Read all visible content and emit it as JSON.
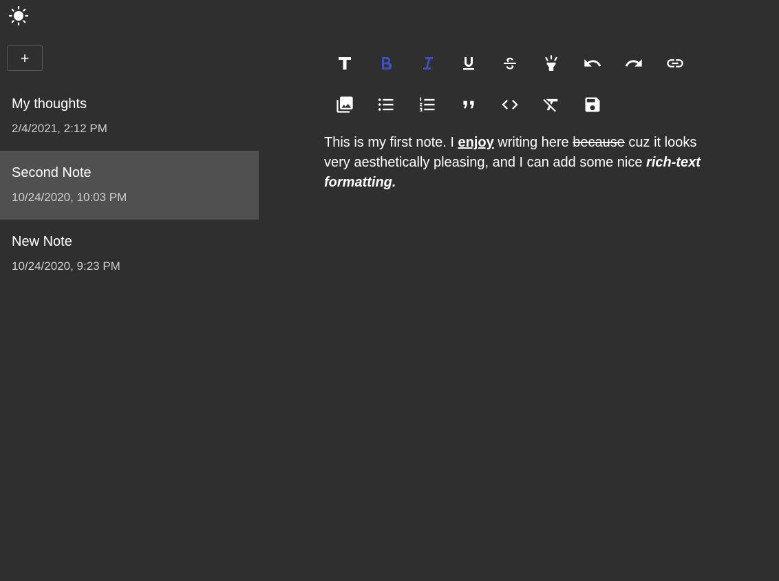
{
  "theme_toggle": {
    "icon": "sun-icon"
  },
  "sidebar": {
    "add_button_label": "+",
    "notes": [
      {
        "title": "My thoughts",
        "date": "2/4/2021, 2:12 PM",
        "selected": false
      },
      {
        "title": "Second Note",
        "date": "10/24/2020, 10:03 PM",
        "selected": true
      },
      {
        "title": "New Note",
        "date": "10/24/2020, 9:23 PM",
        "selected": false
      }
    ]
  },
  "toolbar": {
    "row1": [
      "text-style-icon",
      "bold-icon",
      "italic-icon",
      "underline-icon",
      "strikethrough-icon",
      "highlight-icon",
      "undo-icon",
      "redo-icon",
      "link-icon"
    ],
    "row2": [
      "image-icon",
      "bulleted-list-icon",
      "numbered-list-icon",
      "quote-icon",
      "code-icon",
      "clear-format-icon",
      "save-icon"
    ],
    "active_color": "#3f4fbf",
    "icon_color": "#ffffff"
  },
  "editor": {
    "p1": "This is my first note. I ",
    "p2": "enjoy",
    "p3": " writing here ",
    "p4": "because",
    "p5": " cuz it looks very aesthetically pleasing, and I can add some nice ",
    "p6": "rich-text formatting."
  },
  "colors": {
    "background": "#2f2f2f",
    "selected_item": "#505050",
    "date_text": "#cfcfcf"
  }
}
